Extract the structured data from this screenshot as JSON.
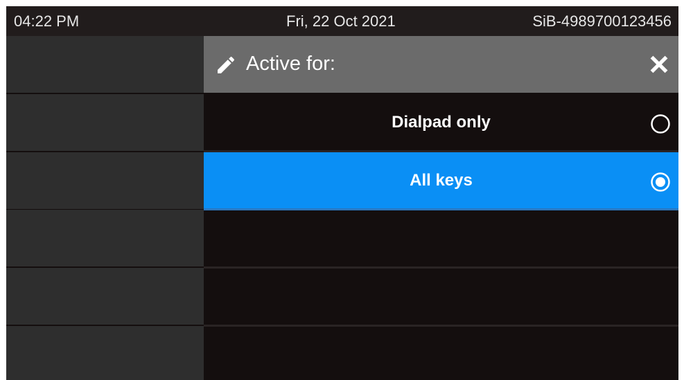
{
  "status_bar": {
    "time": "04:22 PM",
    "date": "Fri, 22 Oct 2021",
    "device_id": "SiB-4989700123456"
  },
  "dialog": {
    "title": "Active for:",
    "title_icon": "pencil-icon",
    "close_icon": "close-icon",
    "options": [
      {
        "label": "Dialpad only",
        "selected": false
      },
      {
        "label": "All keys",
        "selected": true
      }
    ]
  },
  "colors": {
    "selected_row": "#0a8ff5",
    "header": "#6b6b6b",
    "background": "#140e0e",
    "left_tile": "#2e2e2e"
  }
}
